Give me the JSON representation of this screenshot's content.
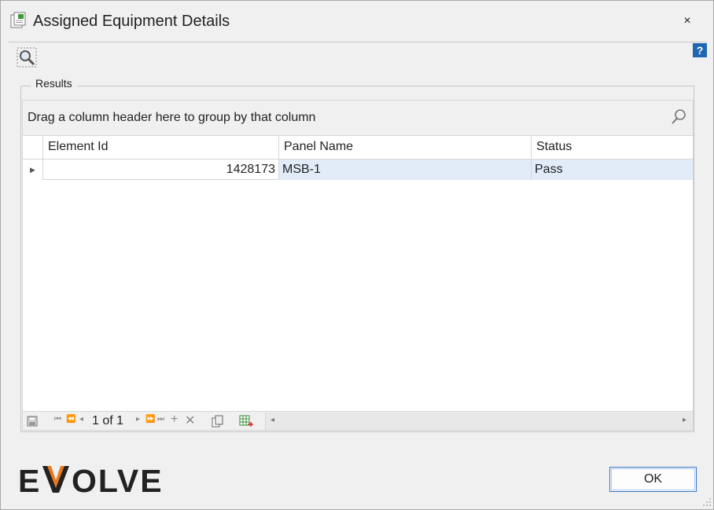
{
  "window": {
    "title": "Assigned Equipment Details",
    "close_glyph": "×"
  },
  "help": {
    "glyph": "?"
  },
  "results": {
    "legend": "Results",
    "group_panel_text": "Drag a column header here to group by that column",
    "columns": [
      "Element Id",
      "Panel Name",
      "Status"
    ],
    "rows": [
      {
        "element_id": "1428173",
        "panel_name": "MSB-1",
        "status": "Pass"
      }
    ],
    "navigator": {
      "page_text": "1 of 1"
    }
  },
  "footer": {
    "logo_text": "EVOLVE",
    "ok_label": "OK"
  },
  "colors": {
    "accent": "#1f66b3",
    "selected_row": "#e2ecf9",
    "logo_orange": "#e8781e",
    "logo_dark": "#222222"
  }
}
